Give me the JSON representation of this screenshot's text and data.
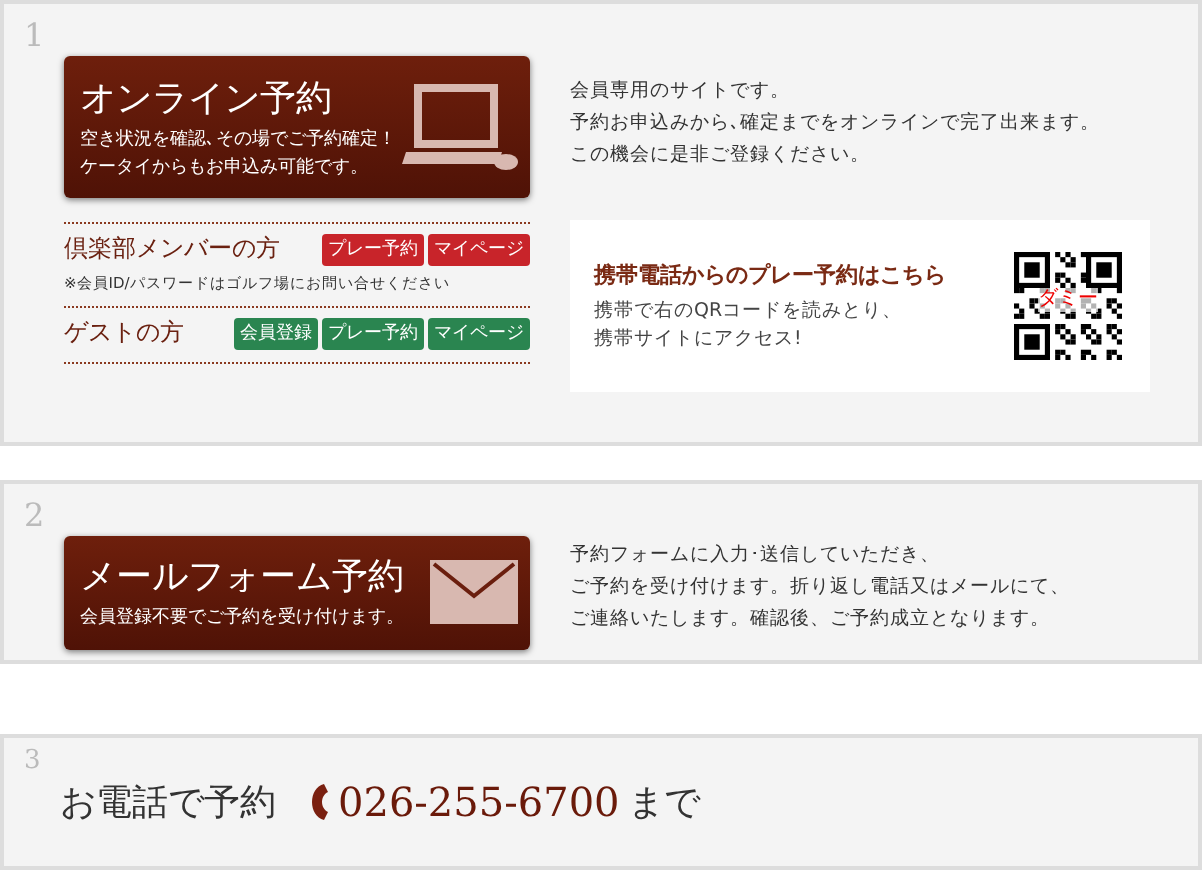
{
  "sections": [
    {
      "number": "1",
      "kind": "online",
      "banner": {
        "title": "オンライン予約",
        "lines": [
          "空き状況を確認､その場でご予約確定！",
          "ケータイからもお申込み可能です。"
        ]
      },
      "description": [
        "会員専用のサイトです。",
        "予約お申込みから､確定までをオンラインで完了出来ます。",
        "この機会に是非ご登録ください。"
      ],
      "access_rows": [
        {
          "label": "倶楽部メンバーの方",
          "kind": "member",
          "buttons": [
            "プレー予約",
            "マイページ"
          ],
          "note": "※会員ID/パスワードはゴルフ場にお問い合せください"
        },
        {
          "label": "ゲストの方",
          "kind": "guest",
          "buttons": [
            "会員登録",
            "プレー予約",
            "マイページ"
          ]
        }
      ],
      "mobile": {
        "title": "携帯電話からのプレー予約はこちら",
        "lines": [
          "携帯で右のQRコードを読みとり、",
          "携帯サイトにアクセス!"
        ],
        "qr_overlay": "ダミー"
      }
    },
    {
      "number": "2",
      "kind": "mail",
      "banner": {
        "title": "メールフォーム予約",
        "lines": [
          "会員登録不要でご予約を受け付けます。"
        ]
      },
      "description": [
        "予約フォームに入力･送信していただき、",
        "ご予約を受け付けます。折り返し電話又はメールにて、",
        "ご連絡いたします。確認後、ご予約成立となります。"
      ]
    },
    {
      "number": "3",
      "kind": "phone",
      "label": "お電話で予約",
      "phone": "026-255-6700",
      "suffix": "まで"
    }
  ]
}
